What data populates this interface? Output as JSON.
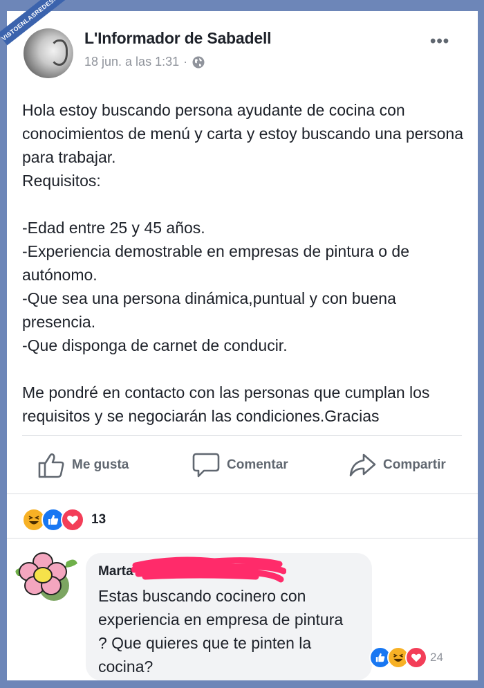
{
  "watermark": "VISTOENLASREDES.com",
  "post": {
    "page_name": "L'Informador de Sabadell",
    "timestamp": "18 jun. a las 1:31",
    "separator": "·",
    "audience_icon": "globe-icon",
    "more_icon": "•••",
    "lines": [
      "Hola estoy buscando persona ayudante de cocina con conocimientos de menú y carta y estoy buscando una persona para trabajar.",
      "Requisitos:",
      "",
      "-Edad entre 25 y 45 años.",
      "-Experiencia demostrable en empresas de pintura o de autónomo.",
      "-Que sea una persona dinámica,puntual y con buena presencia.",
      "-Que disponga de carnet de conducir.",
      "",
      "Me pondré en contacto con las personas que cumplan los requisitos y se negociarán las condiciones.Gracias"
    ]
  },
  "actions": {
    "like_label": "Me gusta",
    "comment_label": "Comentar",
    "share_label": "Compartir"
  },
  "reactions": {
    "icons": [
      "haha-icon",
      "like-icon",
      "love-icon"
    ],
    "count": "13"
  },
  "comment": {
    "author": "Marta",
    "text": "Estas buscando cocinero con experiencia en empresa de pintura ? Que quieres que te pinten la cocina?",
    "reaction_icons": [
      "like-icon",
      "haha-icon",
      "love-icon"
    ],
    "reaction_count": "24"
  },
  "colors": {
    "background": "#6d86b8",
    "text": "#1d2129",
    "secondary_text": "#606770",
    "meta_text": "#90949c",
    "like_blue": "#1877f2",
    "love_red": "#f33e58",
    "haha_yellow": "#f7b125",
    "redaction_pink": "#ff2b6a"
  }
}
